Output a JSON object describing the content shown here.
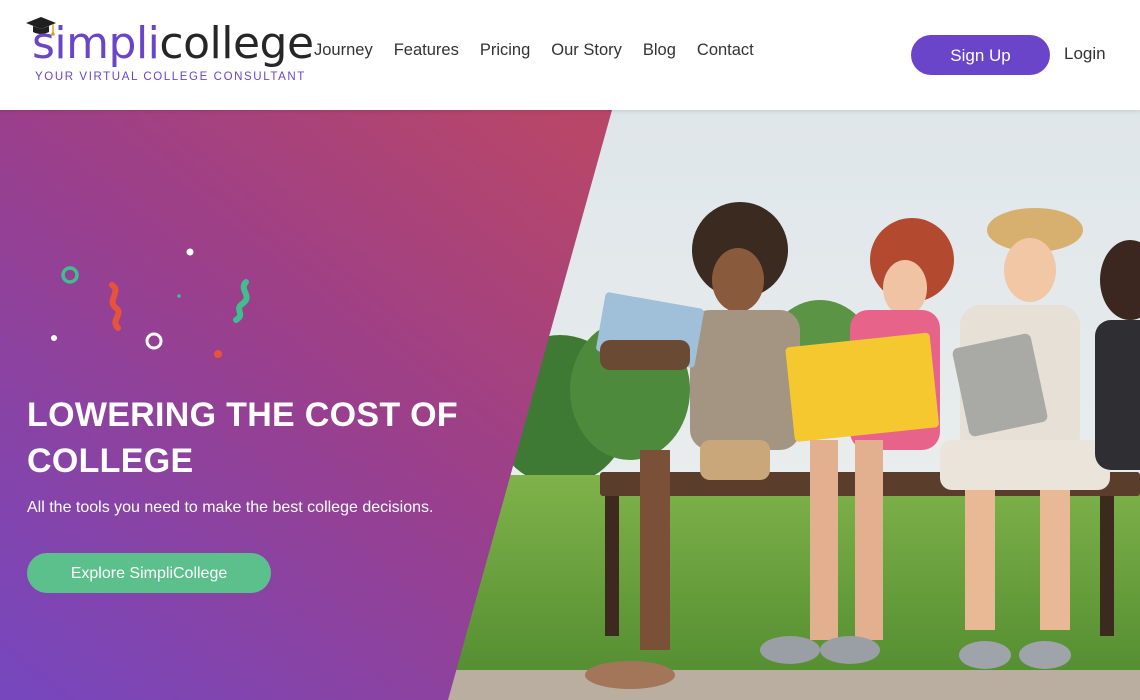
{
  "brand": {
    "name_part1": "simpli",
    "name_part2": "college",
    "tagline": "YOUR VIRTUAL COLLEGE CONSULTANT",
    "primary_color": "#6a45c9",
    "accent_color": "#5cc08c"
  },
  "nav": {
    "items": [
      {
        "label": "Journey"
      },
      {
        "label": "Features"
      },
      {
        "label": "Pricing"
      },
      {
        "label": "Our Story"
      },
      {
        "label": "Blog"
      },
      {
        "label": "Contact"
      }
    ],
    "signup_label": "Sign Up",
    "login_label": "Login"
  },
  "hero": {
    "title": "LOWERING THE COST OF COLLEGE",
    "subtitle": "All the tools you need to make the best college decisions.",
    "cta_label": "Explore SimpliCollege",
    "gradient_top": "#b5446b",
    "gradient_bottom": "#7a43b8"
  }
}
